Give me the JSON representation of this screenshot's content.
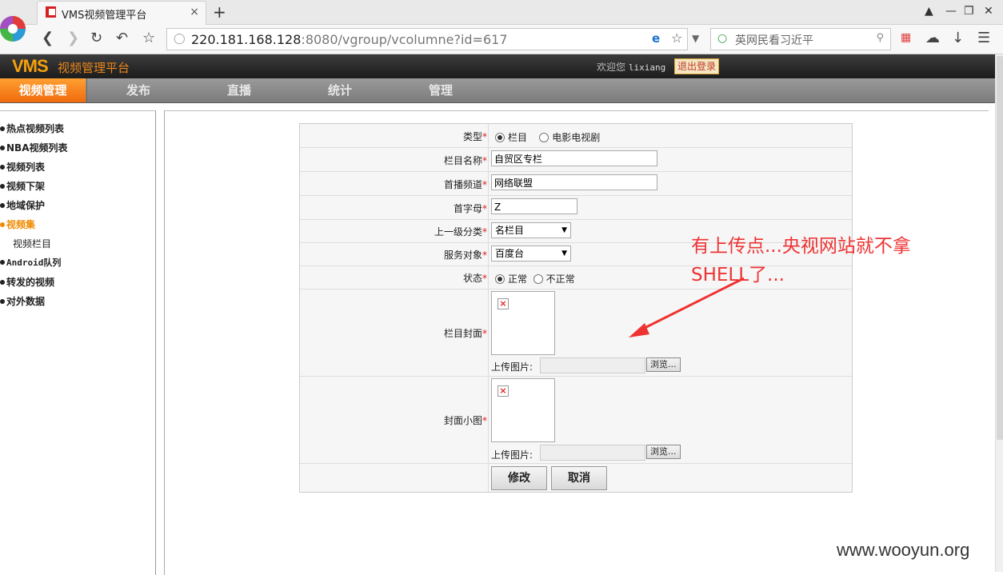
{
  "browser": {
    "tab_title": "VMS视频管理平台",
    "tab_close": "×",
    "new_tab": "+",
    "url_host": "220.181.168.128",
    "url_rest": ":8080/vgroup/vcolumne?id=617",
    "search_placeholder": "英网民看习近平"
  },
  "header": {
    "logo": "VMS",
    "logo_sub": "视频管理平台",
    "welcome": "欢迎您",
    "username": "lixiang",
    "logout": "退出登录"
  },
  "menu": [
    "视频管理",
    "发布",
    "直播",
    "统计",
    "管理"
  ],
  "sidebar": [
    "热点视频列表",
    "NBA视频列表",
    "视频列表",
    "视频下架",
    "地域保护",
    "视频集",
    "视频栏目",
    "Android队列",
    "转发的视频",
    "对外数据"
  ],
  "form": {
    "type_label": "类型",
    "type_opt1": "栏目",
    "type_opt2": "电影电视剧",
    "name_label": "栏目名称",
    "name_value": "自贸区专栏",
    "channel_label": "首播频道",
    "channel_value": "网络联盟",
    "initial_label": "首字母",
    "initial_value": "Z",
    "parent_label": "上一级分类",
    "parent_value": "名栏目",
    "target_label": "服务对象",
    "target_value": "百度台",
    "status_label": "状态",
    "status_opt1": "正常",
    "status_opt2": "不正常",
    "cover_label": "栏目封面",
    "thumb_label": "封面小图",
    "upload_label": "上传图片:",
    "browse": "浏览...",
    "submit": "修改",
    "cancel": "取消",
    "required": "*"
  },
  "annotation": {
    "line1": "有上传点...央视网站就不拿",
    "line2": "SHELL了..."
  },
  "watermark": "www.wooyun.org"
}
